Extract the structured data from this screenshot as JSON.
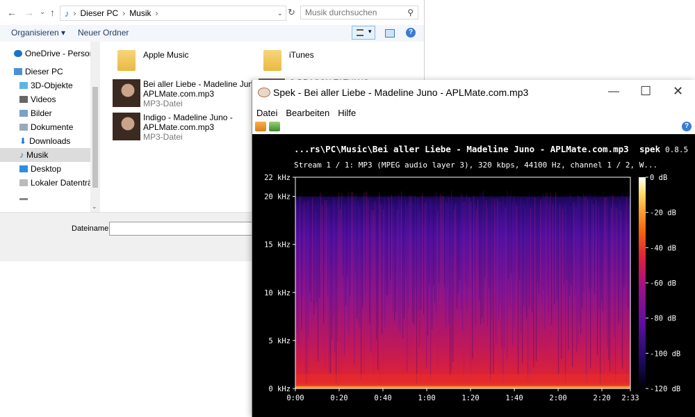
{
  "explorer": {
    "address": {
      "sep_root": "›",
      "seg1": "Dieser PC",
      "sep1": "›",
      "seg2": "Musik",
      "sep2": "›"
    },
    "search_placeholder": "Musik durchsuchen",
    "toolbar": {
      "organize": "Organisieren ▾",
      "new_folder": "Neuer Ordner"
    },
    "nav": [
      "OneDrive - Persona",
      "Dieser PC",
      "3D-Objekte",
      "Videos",
      "Bilder",
      "Dokumente",
      "Downloads",
      "Musik",
      "Desktop",
      "Lokaler Datenträg"
    ],
    "selected_nav": "Musik",
    "folders": [
      "Apple Music",
      "iTunes"
    ],
    "partial_item": "G-DRAGON-TAEYANG",
    "files": [
      {
        "name": "Bei aller Liebe - Madeline Juno -",
        "name2": "APLMate.com.mp3",
        "type": "MP3-Datei"
      },
      {
        "name": "Indigo - Madeline Juno -",
        "name2": "APLMate.com.mp3",
        "type": "MP3-Datei"
      }
    ],
    "filename_label": "Dateiname:"
  },
  "spek": {
    "title": "Spek - Bei aller Liebe - Madeline Juno - APLMate.com.mp3",
    "menu": [
      "Datei",
      "Bearbeiten",
      "Hilfe"
    ],
    "help_glyph": "?",
    "colors": {
      "background": "#000000",
      "text": "#ffffff"
    }
  },
  "chart_data": {
    "type": "heatmap",
    "title": "...rs\\PC\\Music\\Bei aller Liebe - Madeline Juno - APLMate.com.mp3",
    "brand": "spek",
    "version": "0.8.5",
    "subtitle": "Stream 1 / 1: MP3 (MPEG audio layer 3), 320 kbps, 44100 Hz, channel 1 / 2, W...",
    "x_ticks": [
      "0:00",
      "0:20",
      "0:40",
      "1:00",
      "1:20",
      "1:40",
      "2:00",
      "2:20",
      "2:33"
    ],
    "x_tick_seconds": [
      0,
      20,
      40,
      60,
      80,
      100,
      120,
      140,
      153
    ],
    "xlim": [
      0,
      153
    ],
    "y_ticks": [
      "0 kHz",
      "5 kHz",
      "10 kHz",
      "15 kHz",
      "20 kHz",
      "22 kHz"
    ],
    "y_tick_khz": [
      0,
      5,
      10,
      15,
      20,
      22
    ],
    "ylim": [
      0,
      22
    ],
    "colorbar_ticks": [
      "0 dB",
      "-20 dB",
      "-40 dB",
      "-60 dB",
      "-80 dB",
      "-100 dB",
      "-120 dB"
    ],
    "colorbar_db": [
      0,
      -20,
      -40,
      -60,
      -80,
      -100,
      -120
    ],
    "cutoff_khz": 20,
    "colormap": [
      "#000000",
      "#1a0a5a",
      "#5a0ea0",
      "#a0108a",
      "#e0203a",
      "#f86010",
      "#fca030",
      "#fee070",
      "#ffffff"
    ]
  }
}
